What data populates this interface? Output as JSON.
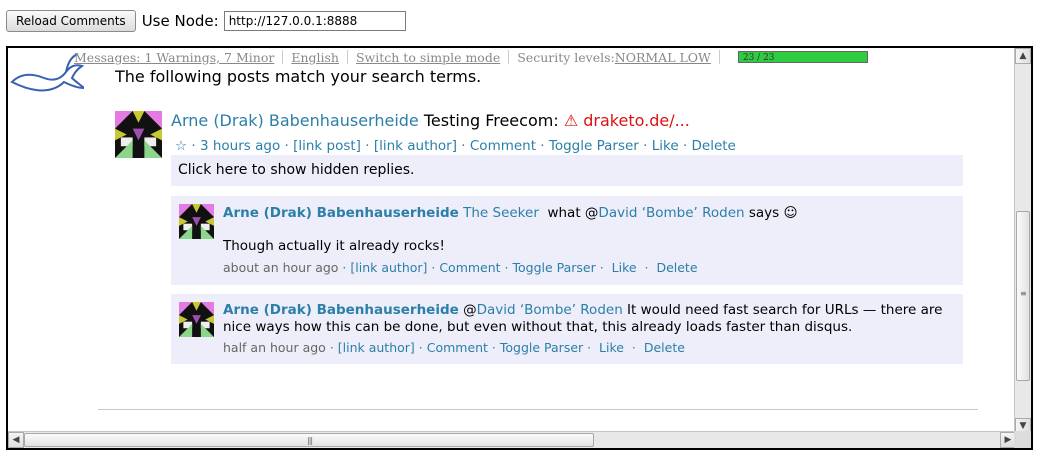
{
  "toolbar": {
    "reload_label": "Reload Comments",
    "use_node_label": "Use Node:",
    "node_value": "http://127.0.0.1:8888"
  },
  "statusbar": {
    "messages": "Messages: 1 Warnings, 7 Minor",
    "language": "English",
    "mode": "Switch to simple mode",
    "security_label": "Security levels:",
    "security_value": "NORMAL LOW",
    "progress_text": "23 / 23",
    "progress_fraction": 1.0,
    "progress_color": "#2ecc40"
  },
  "main": {
    "heading": "The following posts match your search terms.",
    "post": {
      "author": "Arne (Drak) Babenhauserheide",
      "title": "Testing Freecom:",
      "warning_icon": "⚠",
      "link": "draketo.de/...",
      "star": "☆",
      "meta": " · 3 hours ago · [link post] · [link author] · Comment · Toggle Parser ·  Like  ·  Delete",
      "hidden_replies": "Click here to show hidden replies."
    },
    "replies": [
      {
        "author": "Arne (Drak) Babenhauserheide",
        "mention_1": "The Seeker",
        "mid_text": "  what @",
        "mention_2": "David ‘Bombe’ Roden",
        "end_text": " says ☺",
        "body": "Though actually it already rocks!",
        "time": "about an hour ago",
        "actions": " · [link author] · Comment · Toggle Parser ·  Like  ·  Delete"
      },
      {
        "author": "Arne (Drak) Babenhauserheide",
        "at": "@",
        "mention": "David ‘Bombe’ Roden",
        "body": " It would need fast search for URLs — there are nice ways how this can be done, but even without that, this already loads faster than disqus.",
        "time": "half an hour ago",
        "actions": " · [link author] · Comment · Toggle Parser ·  Like  ·  Delete"
      }
    ]
  },
  "colors": {
    "link": "#2b7fa8",
    "warning": "#dd1111",
    "reply_background": "#eeeefb"
  },
  "icons": {
    "logo": "rabbit-logo-icon",
    "avatar": "identicon-avatar-icon",
    "warning": "warning-triangle-icon",
    "star": "star-outline-icon"
  }
}
